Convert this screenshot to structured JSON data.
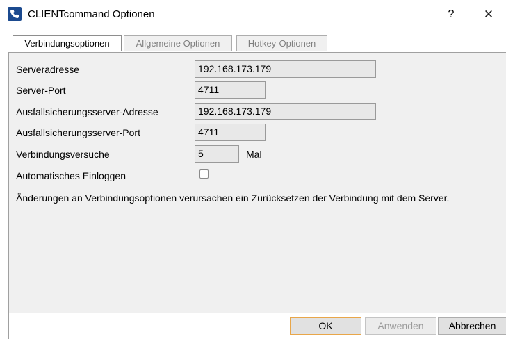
{
  "window": {
    "title": "CLIENTcommand Optionen",
    "app_icon": "phone-icon",
    "help_label": "?",
    "close_label": "✕"
  },
  "tabs": [
    {
      "label": "Verbindungsoptionen",
      "active": true
    },
    {
      "label": "Allgemeine Optionen",
      "active": false
    },
    {
      "label": "Hotkey-Optionen",
      "active": false
    }
  ],
  "form": {
    "server_address": {
      "label": "Serveradresse",
      "value": "192.168.173.179"
    },
    "server_port": {
      "label": "Server-Port",
      "value": "4711"
    },
    "failover_address": {
      "label": "Ausfallsicherungsserver-Adresse",
      "value": "192.168.173.179"
    },
    "failover_port": {
      "label": "Ausfallsicherungsserver-Port",
      "value": "4711"
    },
    "connection_attempts": {
      "label": "Verbindungsversuche",
      "value": "5",
      "unit": "Mal"
    },
    "auto_login": {
      "label": "Automatisches Einloggen",
      "checked": false
    },
    "note": "Änderungen an Verbindungsoptionen verursachen ein Zurücksetzen der Verbindung mit dem Server."
  },
  "buttons": {
    "ok": "OK",
    "apply": "Anwenden",
    "cancel": "Abbrechen"
  },
  "colors": {
    "icon_blue": "#1b4a8f",
    "default_button_border": "#e8a64a",
    "panel_background": "#f0f0f0"
  }
}
